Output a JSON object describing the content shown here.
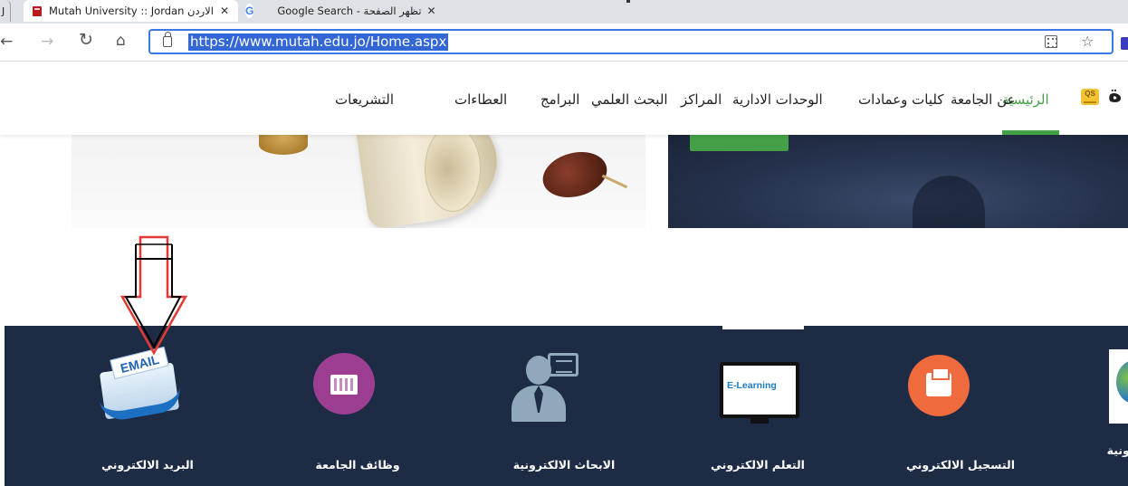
{
  "browser": {
    "tabs": [
      {
        "title": "Mutah University :: Jordan الاردن",
        "close": "✕"
      },
      {
        "title": "Google Search - تظهر الصفحة",
        "close": "✕"
      }
    ],
    "left_tab_glyph": "J",
    "new_tab": "+",
    "url": "https://www.mutah.edu.jo/Home.aspx",
    "back_icon": "back-arrow-icon",
    "forward_icon": "forward-arrow-icon",
    "reload_icon": "reload-icon",
    "home_icon": "home-icon"
  },
  "site": {
    "brand_fragment": "ة",
    "logo_text": "QS",
    "nav": [
      {
        "label": "الرئيسية",
        "active": true
      },
      {
        "label": "عن الجامعة",
        "active": false
      },
      {
        "label": "كليات وعمادات",
        "active": false
      },
      {
        "label": "الوحدات الادارية",
        "active": false
      },
      {
        "label": "المراكز",
        "active": false
      },
      {
        "label": "البحث العلمي",
        "active": false
      },
      {
        "label": "البرامج",
        "active": false
      },
      {
        "label": "العطاءات",
        "active": false
      },
      {
        "label": "التشريعات",
        "active": false
      }
    ],
    "accent_color": "#43a047"
  },
  "services": [
    {
      "label": "البريد الالكتروني",
      "icon": "email-icon"
    },
    {
      "label": "وظائف الجامعة",
      "icon": "keyboard-icon"
    },
    {
      "label": "الابحاث الالكترونية",
      "icon": "person-speech-icon"
    },
    {
      "label": "التعلم الالكتروني",
      "icon": "e-learning-monitor-icon",
      "icon_text": "E-Learning"
    },
    {
      "label": "التسجيل الالكتروني",
      "icon": "printer-icon"
    },
    {
      "label": "رونية",
      "icon": "globe-icon"
    }
  ],
  "email_icon_text": "EMAIL",
  "services_bg": "#1e2b45",
  "annotation": {
    "color": "#e53935",
    "icon": "down-arrow-annotation"
  }
}
